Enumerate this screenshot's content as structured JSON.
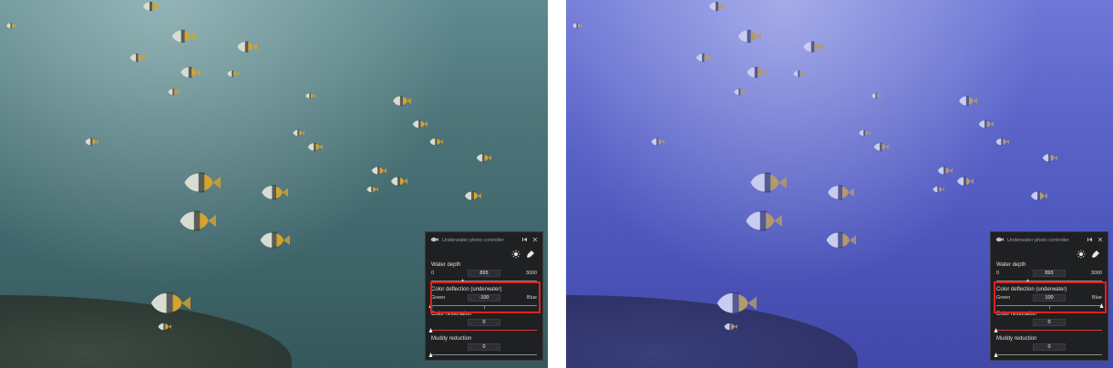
{
  "panels": [
    {
      "side": "left",
      "title": "Underwater photo controller",
      "water_depth": {
        "label": "Water depth",
        "min_label": "0",
        "value": "893",
        "max_label": "3000",
        "fraction": 0.3
      },
      "color_deflection": {
        "label": "Color deflection (underwater)",
        "left_label": "Green",
        "value": "-100",
        "right_label": "Blue",
        "fraction": 0.0
      },
      "color_restoration": {
        "label": "Color restoration",
        "value": "0",
        "fraction": 0.0
      },
      "muddy_reduction": {
        "label": "Muddy reduction",
        "value": "0",
        "fraction": 0.0
      }
    },
    {
      "side": "right",
      "title": "Underwater photo controller",
      "water_depth": {
        "label": "Water depth",
        "min_label": "0",
        "value": "893",
        "max_label": "3000",
        "fraction": 0.3
      },
      "color_deflection": {
        "label": "Color deflection (underwater)",
        "left_label": "Green",
        "value": "100",
        "right_label": "Blue",
        "fraction": 1.0
      },
      "color_restoration": {
        "label": "Color restoration",
        "value": "0",
        "fraction": 0.0
      },
      "muddy_reduction": {
        "label": "Muddy reduction",
        "value": "0",
        "fraction": 0.0
      }
    }
  ],
  "icons": {
    "titlebar_logo": "fish-icon",
    "pin": "pin-icon",
    "close": "close-icon",
    "brightness": "sun-icon",
    "eyedropper": "eyedropper-icon"
  },
  "colors": {
    "highlight": "#e02020",
    "panel_bg": "#1f2022",
    "left_photo_tone": "#4c7478",
    "right_photo_tone": "#5a63c8"
  }
}
